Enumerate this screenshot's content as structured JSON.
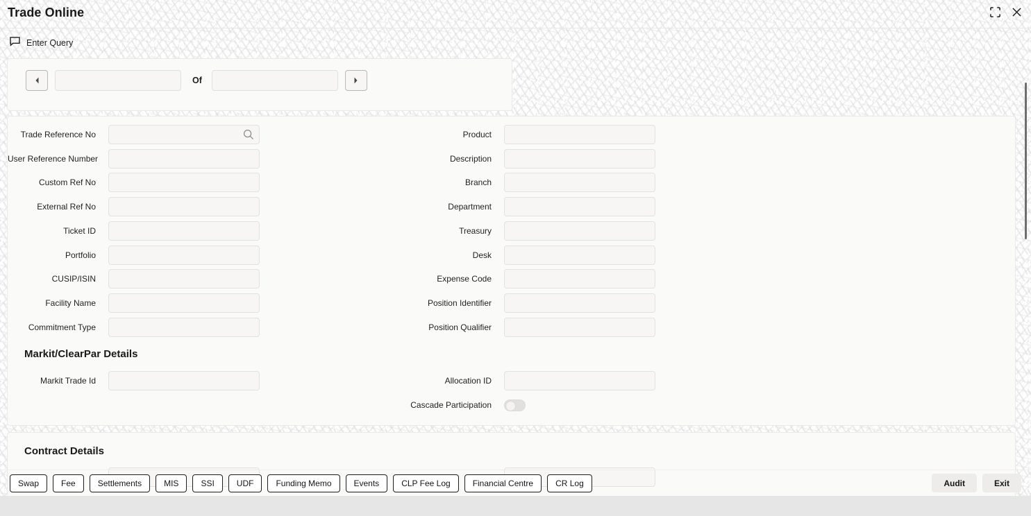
{
  "window": {
    "title": "Trade Online",
    "collapse_icon": "collapse-icon",
    "close_icon": "close-icon"
  },
  "query_bar": {
    "icon": "comment-icon",
    "label": "Enter Query"
  },
  "navigation": {
    "prev_icon": "chevron-left-icon",
    "next_icon": "chevron-right-icon",
    "current_value": "",
    "current_placeholder": "",
    "of_label": "Of",
    "total_value": "",
    "total_placeholder": ""
  },
  "main_form": {
    "left_fields": [
      {
        "label": "Trade Reference No",
        "value": "",
        "icon": "search-icon"
      },
      {
        "label": "User Reference Number",
        "value": ""
      },
      {
        "label": "Custom Ref No",
        "value": ""
      },
      {
        "label": "External Ref No",
        "value": ""
      },
      {
        "label": "Ticket ID",
        "value": ""
      },
      {
        "label": "Portfolio",
        "value": ""
      },
      {
        "label": "CUSIP/ISIN",
        "value": ""
      },
      {
        "label": "Facility Name",
        "value": ""
      },
      {
        "label": "Commitment Type",
        "value": ""
      }
    ],
    "right_fields": [
      {
        "label": "Product",
        "value": ""
      },
      {
        "label": "Description",
        "value": ""
      },
      {
        "label": "Branch",
        "value": ""
      },
      {
        "label": "Department",
        "value": ""
      },
      {
        "label": "Treasury",
        "value": ""
      },
      {
        "label": "Desk",
        "value": ""
      },
      {
        "label": "Expense Code",
        "value": ""
      },
      {
        "label": "Position Identifier",
        "value": ""
      },
      {
        "label": "Position Qualifier",
        "value": ""
      }
    ]
  },
  "markit_section": {
    "heading": "Markit/ClearPar Details",
    "markit_trade_id_label": "Markit Trade Id",
    "markit_trade_id_value": "",
    "allocation_id_label": "Allocation ID",
    "allocation_id_value": "",
    "cascade_label": "Cascade Participation",
    "cascade_on": false
  },
  "contract_section": {
    "heading": "Contract Details"
  },
  "toolbar": {
    "left_buttons": [
      "Swap",
      "Fee",
      "Settlements",
      "MIS",
      "SSI",
      "UDF",
      "Funding Memo",
      "Events",
      "CLP Fee Log",
      "Financial Centre",
      "CR Log"
    ],
    "right_buttons": [
      "Audit",
      "Exit"
    ]
  },
  "colors": {
    "page_bg": "#ffffff",
    "card_bg": "#fafaf9",
    "input_bg": "#f7f6f4",
    "text": "#161513",
    "statusbar": "#e6e6e6",
    "scrollbar_thumb": "#6e6e6e"
  }
}
